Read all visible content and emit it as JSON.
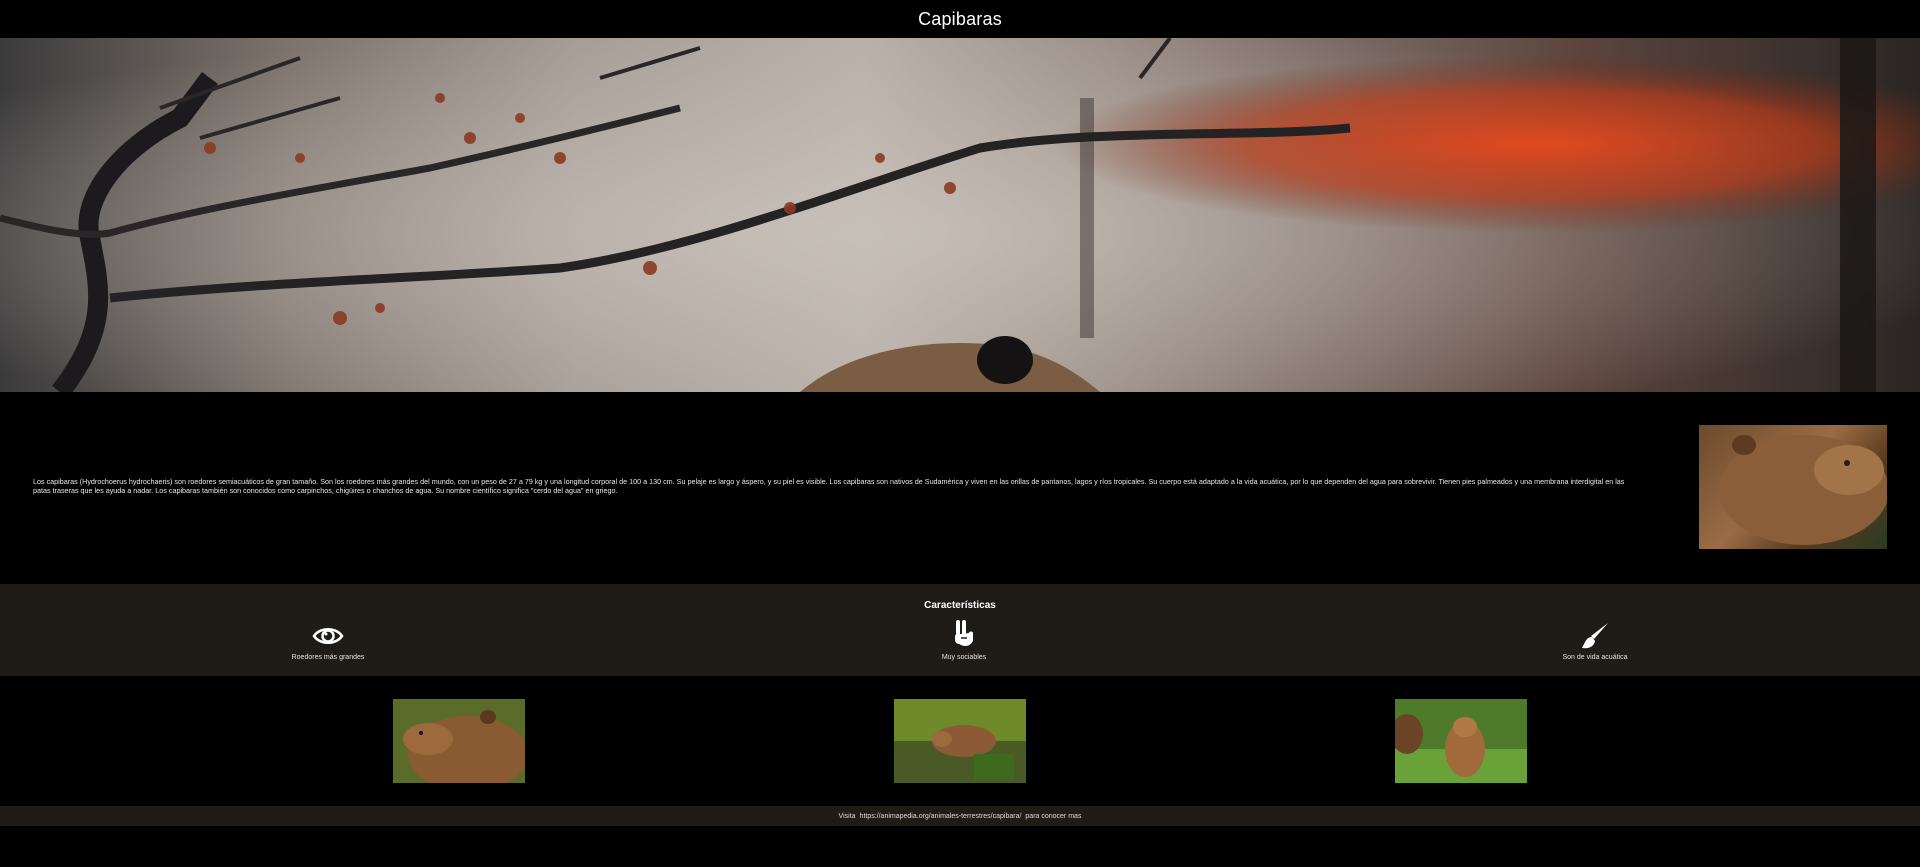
{
  "header": {
    "title": "Capibaras"
  },
  "intro": {
    "text": "Los capibaras (Hydrochoerus hydrochaeris) son roedores semiacuáticos de gran tamaño. Son los roedores más grandes del mundo, con un peso de 27 a 79 kg y una longitud corporal de 100 a 130 cm. Su pelaje es largo y áspero, y su piel es visible. Los capibaras son nativos de Sudamérica y viven en las orillas de pantanos, lagos y ríos tropicales. Su cuerpo está adaptado a la vida acuática, por lo que dependen del agua para sobrevivir. Tienen pies palmeados y una membrana interdigital en las patas traseras que les ayuda a nadar. Los capibaras también son conocidos como carpinchos, chigüires o chanchos de agua. Su nombre científico significa \"cerdo del agua\" en griego."
  },
  "features": {
    "heading": "Características",
    "items": [
      {
        "label": "Roedores más grandes",
        "icon": "eye-icon"
      },
      {
        "label": "Muy sociables",
        "icon": "peace-hand-icon"
      },
      {
        "label": "Son de vida acuática",
        "icon": "paintbrush-icon"
      }
    ]
  },
  "footer": {
    "prefix": "Visita",
    "link": "https://animapedia.org/animales-terrestres/capibara/",
    "suffix": "para conocer mas"
  },
  "colors": {
    "background": "#000000",
    "band": "#1f1b17",
    "text": "#ffffff"
  }
}
